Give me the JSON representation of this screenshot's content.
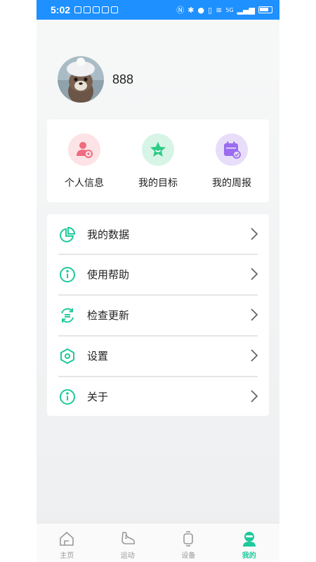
{
  "status_bar": {
    "time": "5:02",
    "network": "5G"
  },
  "profile": {
    "username": "888"
  },
  "quick_actions": [
    {
      "label": "个人信息",
      "icon": "user-settings-icon",
      "bg": "#fde3e6",
      "color": "#f06b7d"
    },
    {
      "label": "我的目标",
      "icon": "star-icon",
      "bg": "#d7f5e6",
      "color": "#2ecb86"
    },
    {
      "label": "我的周报",
      "icon": "calendar-check-icon",
      "bg": "#e8defa",
      "color": "#9b6cf0"
    }
  ],
  "menu": [
    {
      "label": "我的数据",
      "icon": "pie-chart-icon"
    },
    {
      "label": "使用帮助",
      "icon": "info-icon"
    },
    {
      "label": "检查更新",
      "icon": "refresh-icon"
    },
    {
      "label": "设置",
      "icon": "hexagon-settings-icon"
    },
    {
      "label": "关于",
      "icon": "info-icon"
    }
  ],
  "tabs": [
    {
      "label": "主页",
      "icon": "home-icon",
      "active": false
    },
    {
      "label": "运动",
      "icon": "shoe-icon",
      "active": false
    },
    {
      "label": "设备",
      "icon": "watch-icon",
      "active": false
    },
    {
      "label": "我的",
      "icon": "person-icon",
      "active": true
    }
  ],
  "colors": {
    "accent": "#1ec99b",
    "status_bar": "#1e90ff"
  }
}
